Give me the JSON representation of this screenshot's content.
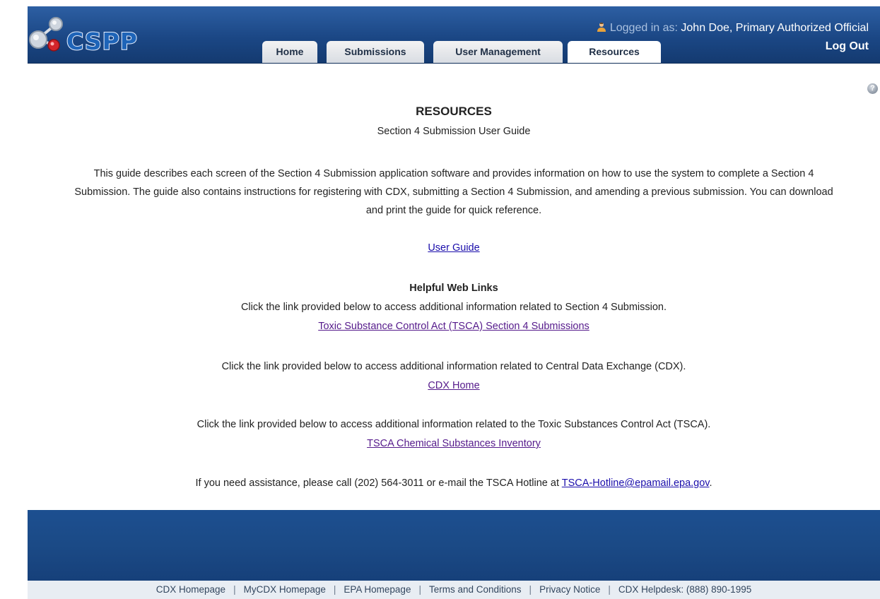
{
  "header": {
    "logo_text": "CSPP",
    "logged_in_prefix": "Logged in as:",
    "logged_in_user": "John Doe, Primary Authorized Official",
    "logout_label": "Log Out"
  },
  "tabs": [
    {
      "label": "Home",
      "active": false
    },
    {
      "label": "Submissions",
      "active": false
    },
    {
      "label": "User Management",
      "active": false
    },
    {
      "label": "Resources",
      "active": true
    }
  ],
  "help_icon_glyph": "?",
  "main": {
    "title": "RESOURCES",
    "subtitle": "Section 4 Submission User Guide",
    "intro": "This guide describes each screen of the Section 4 Submission application software and provides information on how to use the system to complete a Section 4 Submission. The guide also contains instructions for registering with CDX, submitting a Section 4 Submission, and amending a previous submission. You can download and print the guide for quick reference.",
    "user_guide_link": "User Guide",
    "helpful_heading": "Helpful Web Links",
    "helpful_text": "Click the link provided below to access additional information related to Section 4 Submission.",
    "tsca_submissions_link": "Toxic Substance Control Act (TSCA) Section 4 Submissions",
    "cdx_text": "Click the link provided below to access additional information related to Central Data Exchange (CDX).",
    "cdx_link": "CDX Home",
    "tsca_text": "Click the link provided below to access additional information related to the Toxic Substances Control Act (TSCA).",
    "inventory_link": "TSCA Chemical Substances Inventory",
    "assist_prefix": "If you need assistance, please call (202) 564-3011 or e-mail the TSCA Hotline at",
    "assist_email": "TSCA-Hotline@epamail.epa.gov",
    "assist_suffix": "."
  },
  "footer": {
    "links": [
      "CDX Homepage",
      "MyCDX Homepage",
      "EPA Homepage",
      "Terms and Conditions",
      "Privacy Notice",
      "CDX Helpdesk: (888) 890-1995"
    ],
    "separator": "|"
  },
  "colors": {
    "header_blue": "#1b4785",
    "link": "#1a0dab",
    "visited_link": "#551a8b",
    "footer_band": "#1b4a86"
  }
}
